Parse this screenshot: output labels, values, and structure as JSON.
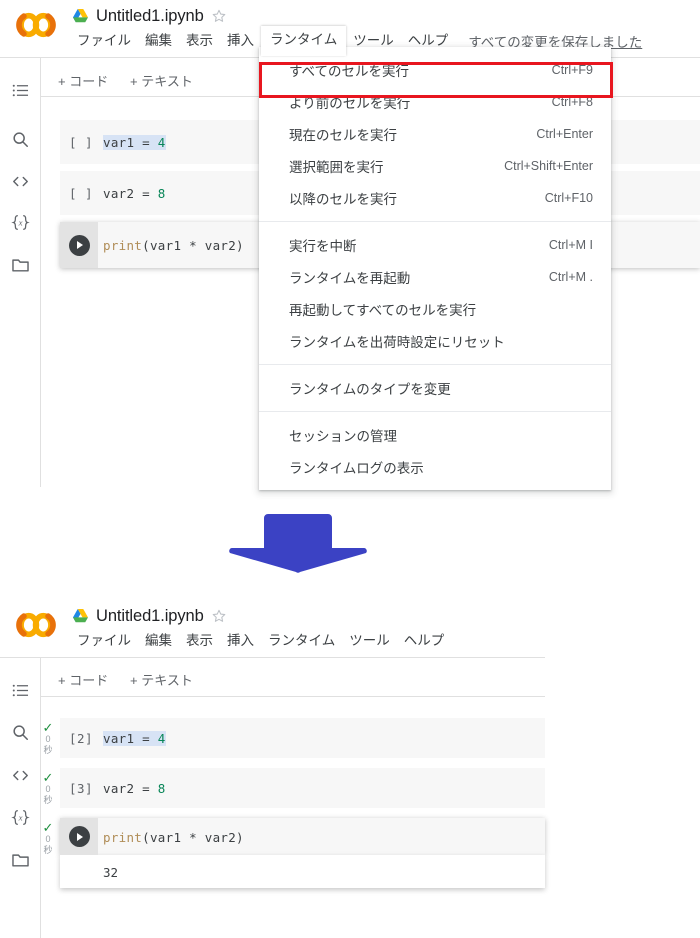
{
  "app": {
    "name": "Colab",
    "logo_icon": "colab-logo"
  },
  "top_panel": {
    "title": "Untitled1.ipynb",
    "drive_icon": "drive-icon",
    "star_icon": "star-icon",
    "menus": [
      {
        "label": "ファイル",
        "active": false
      },
      {
        "label": "編集",
        "active": false
      },
      {
        "label": "表示",
        "active": false
      },
      {
        "label": "挿入",
        "active": false
      },
      {
        "label": "ランタイム",
        "active": true
      },
      {
        "label": "ツール",
        "active": false
      },
      {
        "label": "ヘルプ",
        "active": false
      }
    ],
    "save_status": "すべての変更を保存しました",
    "toolbar": {
      "add_code": "+ コード",
      "add_text": "+ テキスト"
    },
    "rail_icons": [
      "table-of-contents-icon",
      "search-icon",
      "code-snippets-icon",
      "variables-icon",
      "files-folder-icon"
    ],
    "cells": [
      {
        "prompt": "[ ]",
        "code_prefix": "var1",
        "code_op": " = ",
        "code_value": "4",
        "selected": true,
        "focused": false
      },
      {
        "prompt": "[ ]",
        "code_prefix": "var2",
        "code_op": " = ",
        "code_value": "8",
        "selected": false,
        "focused": false
      },
      {
        "prompt": "",
        "code_fn": "print",
        "code_args": "(var1 * var2)",
        "selected": false,
        "focused": true,
        "run_icon": "play-icon"
      }
    ]
  },
  "dropdown": {
    "groups": [
      [
        {
          "label": "すべてのセルを実行",
          "accel": "Ctrl+F9",
          "highlighted": true
        },
        {
          "label": "より前のセルを実行",
          "accel": "Ctrl+F8",
          "highlighted": false
        },
        {
          "label": "現在のセルを実行",
          "accel": "Ctrl+Enter",
          "highlighted": false
        },
        {
          "label": "選択範囲を実行",
          "accel": "Ctrl+Shift+Enter",
          "highlighted": false
        },
        {
          "label": "以降のセルを実行",
          "accel": "Ctrl+F10",
          "highlighted": false
        }
      ],
      [
        {
          "label": "実行を中断",
          "accel": "Ctrl+M I",
          "highlighted": false
        },
        {
          "label": "ランタイムを再起動",
          "accel": "Ctrl+M .",
          "highlighted": false
        },
        {
          "label": "再起動してすべてのセルを実行",
          "accel": "",
          "highlighted": false
        },
        {
          "label": "ランタイムを出荷時設定にリセット",
          "accel": "",
          "highlighted": false
        }
      ],
      [
        {
          "label": "ランタイムのタイプを変更",
          "accel": "",
          "highlighted": false
        }
      ],
      [
        {
          "label": "セッションの管理",
          "accel": "",
          "highlighted": false
        },
        {
          "label": "ランタイムログの表示",
          "accel": "",
          "highlighted": false
        }
      ]
    ],
    "highlight_color": "#e8161f"
  },
  "arrow": {
    "icon": "down-arrow-icon",
    "color": "#3b42c4"
  },
  "bottom_panel": {
    "title": "Untitled1.ipynb",
    "drive_icon": "drive-icon",
    "star_icon": "star-icon",
    "menus": [
      {
        "label": "ファイル"
      },
      {
        "label": "編集"
      },
      {
        "label": "表示"
      },
      {
        "label": "挿入"
      },
      {
        "label": "ランタイム"
      },
      {
        "label": "ツール"
      },
      {
        "label": "ヘルプ"
      }
    ],
    "toolbar": {
      "add_code": "+ コード",
      "add_text": "+ テキスト"
    },
    "rail_icons": [
      "table-of-contents-icon",
      "search-icon",
      "code-snippets-icon",
      "variables-icon",
      "files-folder-icon"
    ],
    "cells": [
      {
        "prompt": "[2]",
        "code_prefix": "var1",
        "code_op": " = ",
        "code_value": "4",
        "selected": true,
        "status": {
          "check": "✓",
          "count": "0",
          "unit": "秒"
        }
      },
      {
        "prompt": "[3]",
        "code_prefix": "var2",
        "code_op": " = ",
        "code_value": "8",
        "selected": false,
        "status": {
          "check": "✓",
          "count": "0",
          "unit": "秒"
        }
      },
      {
        "prompt": "",
        "code_fn": "print",
        "code_args": "(var1 * var2)",
        "focused": true,
        "run_icon": "play-icon",
        "output": "32",
        "status": {
          "check": "✓",
          "count": "0",
          "unit": "秒"
        }
      }
    ]
  }
}
